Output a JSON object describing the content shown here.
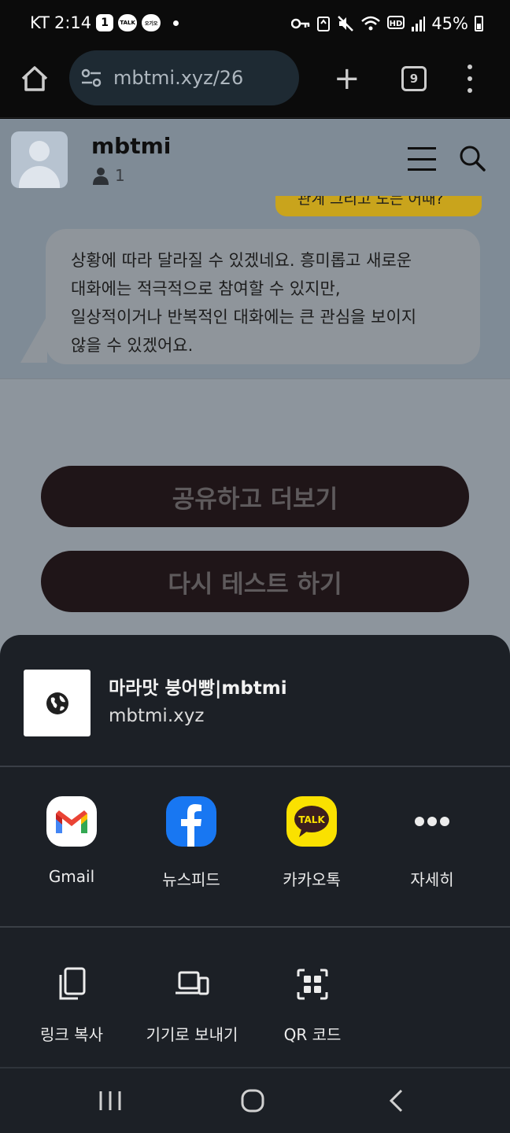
{
  "status_bar": {
    "carrier": "KT",
    "time": "2:14",
    "notif_count": "1",
    "talk_badge": "TALK",
    "extra_badge": "오기오",
    "battery": "45%"
  },
  "browser": {
    "url": "mbtmi.xyz/26",
    "tabs_count": "9"
  },
  "page": {
    "site_name": "mbtmi",
    "member_count": "1",
    "yellow_bubble_text": "관계 그리고 도는 어때?",
    "chat_text": "상황에 따라 달라질 수 있겠네요. 흥미롭고 새로운\n대화에는 적극적으로 참여할 수 있지만,\n일상적이거나 반복적인 대화에는 큰 관심을 보이지\n않을 수 있겠어요.",
    "share_more_label": "공유하고 더보기",
    "retest_label": "다시 테스트 하기"
  },
  "share_sheet": {
    "preview_title": "마라맛 붕어빵|mbtmi",
    "preview_url": "mbtmi.xyz",
    "apps": [
      {
        "label": "Gmail",
        "icon": "gmail-icon"
      },
      {
        "label": "뉴스피드",
        "icon": "facebook-icon"
      },
      {
        "label": "카카오톡",
        "icon": "kakaotalk-icon"
      },
      {
        "label": "자세히",
        "icon": "more-icon"
      }
    ],
    "kakao_badge": "TALK",
    "actions": [
      {
        "label": "링크 복사",
        "icon": "copy-icon"
      },
      {
        "label": "기기로 보내기",
        "icon": "send-to-device-icon"
      },
      {
        "label": "QR 코드",
        "icon": "qr-code-icon"
      }
    ]
  },
  "colors": {
    "sheet_bg": "#1c2026",
    "facebook_blue": "#1877f2",
    "kakao_yellow": "#fae100",
    "cta_bg": "#1f1518"
  }
}
